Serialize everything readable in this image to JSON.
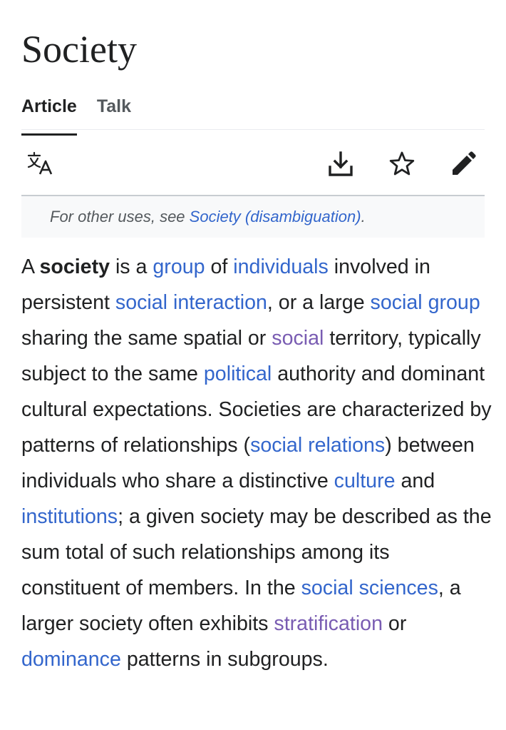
{
  "article": {
    "title": "Society"
  },
  "tabs": [
    {
      "label": "Article",
      "active": true
    },
    {
      "label": "Talk",
      "active": false
    }
  ],
  "toolbar": {
    "icons": [
      "language-icon",
      "download-icon",
      "star-icon",
      "edit-icon"
    ]
  },
  "hatnote": {
    "prefix": "For other uses, see ",
    "link": "Society (disambiguation)",
    "suffix": "."
  },
  "paragraph": {
    "t1": "A ",
    "bold": "society",
    "t2": " is a ",
    "l1": "group",
    "t3": " of ",
    "l2": "individuals",
    "t4": " involved in persistent ",
    "l3": "social interaction",
    "t5": ", or a large ",
    "l4": "social group",
    "t6": " sharing the same spatial or ",
    "l5": "social",
    "t7": " territory, typically subject to the same ",
    "l6": "political",
    "t8": " authority and dominant cultural expectations. Societies are characterized by patterns of relationships (",
    "l7": "social relations",
    "t9": ") between individuals who share a distinctive ",
    "l8": "culture",
    "t10": " and ",
    "l9": "institutions",
    "t11": "; a given society may be described as the sum total of such relationships among its constituent of members. In the ",
    "l10": "social sciences",
    "t12": ", a larger society often exhibits ",
    "l11": "stratification",
    "t13": " or ",
    "l12": "dominance",
    "t14": " patterns in subgroups."
  },
  "colors": {
    "link": "#3366cc",
    "visited_link": "#795cb2",
    "text": "#202122",
    "muted": "#54595d",
    "hatnote_bg": "#f8f9fa"
  }
}
